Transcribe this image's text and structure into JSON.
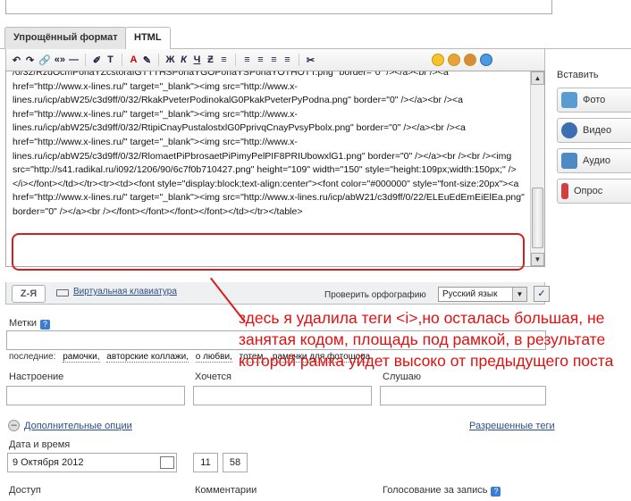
{
  "tabs": {
    "simple": "Упрощённый формат",
    "html": "HTML"
  },
  "toolbar": {
    "undo": "↶",
    "redo": "↷",
    "link": "🔗",
    "quote": "«»",
    "dash": "—",
    "highlight": "✐",
    "font_size": "T",
    "text_color": "A",
    "marker": "✎",
    "bold": "Ж",
    "italic": "К",
    "underline": "Ч",
    "strike": "Ƶ",
    "list": "≡",
    "align_left": "≡",
    "align_center": "≡",
    "align_right": "≡",
    "justify": "≡",
    "cut": "✂"
  },
  "editor": {
    "code": "/0/32/RzdOcmPonaYZcstoraIGTTTHSPonaYGOPonaYSPonaYOTHOTT.png\" border=\"0\" /></a><br /><a href=\"http://www.x-lines.ru/\" target=\"_blank\"><img src=\"http://www.x-lines.ru/icp/abW25/c3d9ff/0/32/RkakPveterPodinokalG0PkakPveterPyPodna.png\" border=\"0\" /></a><br /><a href=\"http://www.x-lines.ru/\" target=\"_blank\"><img src=\"http://www.x-lines.ru/icp/abW25/c3d9ff/0/32/RtipiCnayPustalostxlG0PprivqCnayPvsyPbolx.png\" border=\"0\" /></a><br /><a href=\"http://www.x-lines.ru/\" target=\"_blank\"><img src=\"http://www.x-lines.ru/icp/abW25/c3d9ff/0/32/RlomaetPiPbrosaetPiPimyPelPIF8PRIUbowxlG1.png\" border=\"0\" /></a><br /><br /><img src=\"http://s41.radikal.ru/i092/1206/90/6c7f0b710427.png\" height=\"109\" width=\"150\" style=\"height:109px;width:150px;\" /></i></font></td></tr><tr><td><font style=\"display:block;text-align:center\"><font color=\"#000000\" style=\"font-size:20px\"><a href=\"http://www.x-lines.ru/\" target=\"_blank\"><img src=\"http://www.x-lines.ru/icp/abW21/c3d9ff/0/22/ELEuEdEmEiElEa.png\" border=\"0\" /></a><br /></font></font></font></font></td></tr></table>"
  },
  "sidebar": {
    "title": "Вставить",
    "photo": "Фото",
    "video": "Видео",
    "audio": "Аудио",
    "poll": "Опрос"
  },
  "bottom": {
    "zya": "Z-Я",
    "keyboard": "Виртуальная клавиатура",
    "spellcheck": "Проверить орфографию",
    "language": "Русский язык"
  },
  "form": {
    "tags_label": "Метки",
    "recent_label": "последние:",
    "recent_tags": [
      "рамочки,",
      "авторские коллажи,",
      "о любви,",
      "тотем,",
      "рамочки для фотошопа"
    ],
    "mood_label": "Настроение",
    "want_label": "Хочется",
    "listen_label": "Слушаю",
    "more_options": "Дополнительные опции",
    "allowed_tags": "Разрешенные теги",
    "datetime_label": "Дата и время",
    "date_value": "9 Октября 2012",
    "hour": "11",
    "minute": "58",
    "access_label": "Доступ",
    "comments_label": "Комментарии",
    "vote_label": "Голосование за запись"
  },
  "annotation": "здесь я удалила теги <i>,но осталась большая, не занятая кодом, площадь под рамкой, в результате которой рамка уйдет высоко  от предыдущего поста",
  "colors": {
    "accent_red": "#e01010",
    "link": "#2a4e86"
  }
}
